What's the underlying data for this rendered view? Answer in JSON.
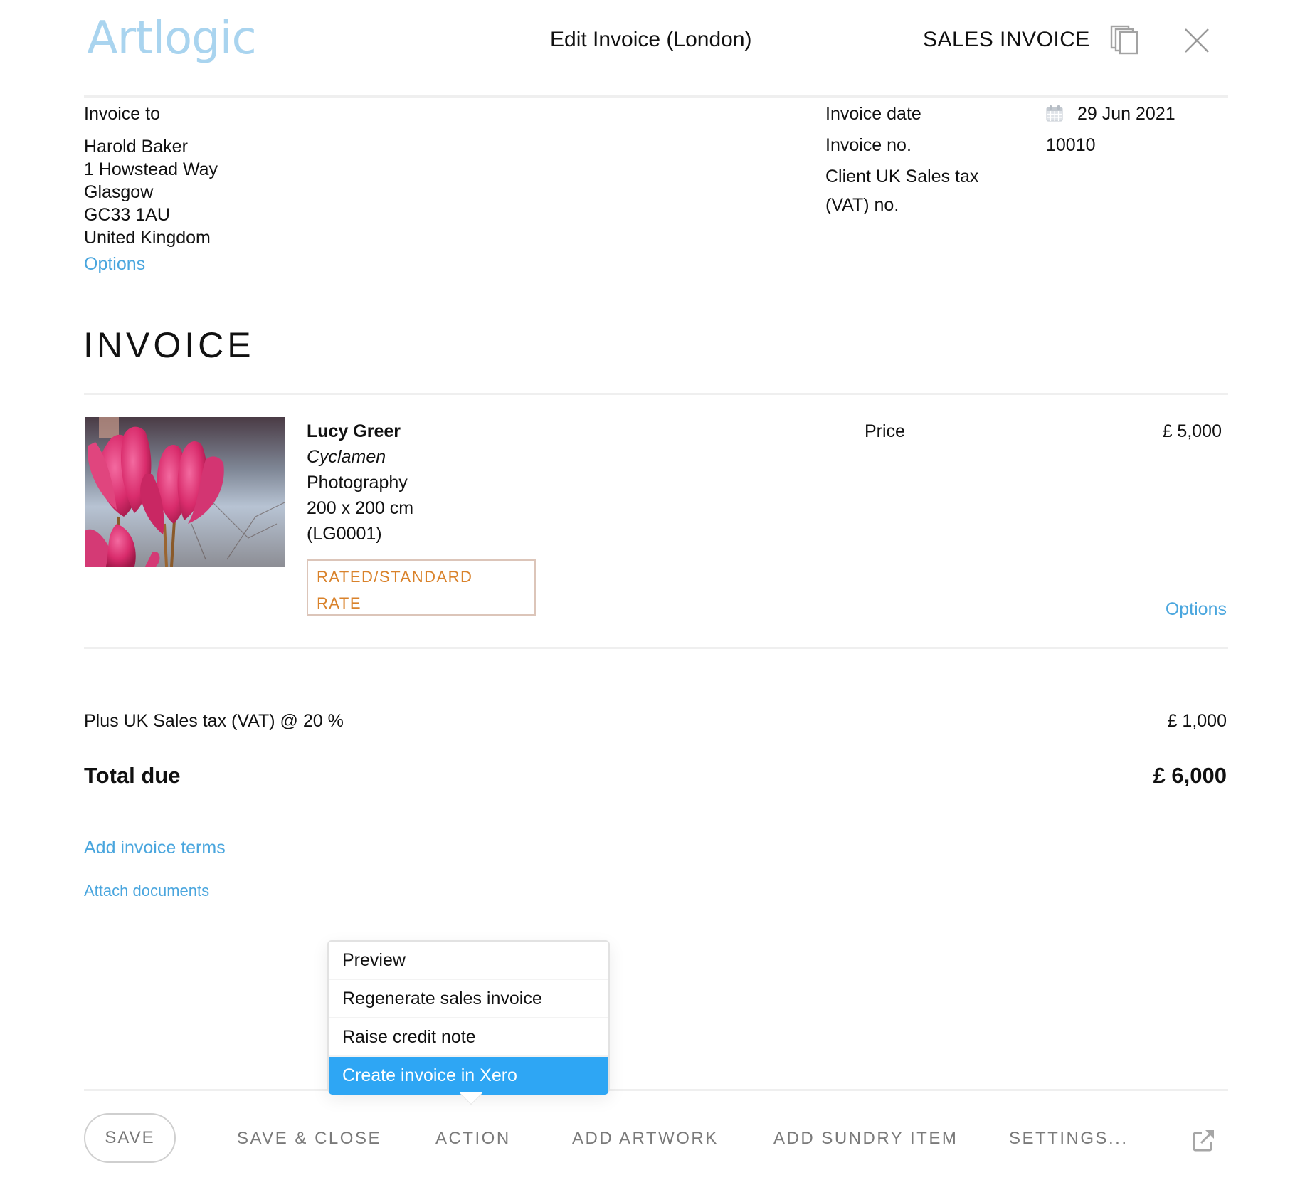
{
  "header": {
    "logo": "Artlogic",
    "title": "Edit Invoice (London)",
    "document_type": "SALES INVOICE",
    "icons": {
      "copy": "copy-icon",
      "close": "close-icon"
    }
  },
  "invoice_to": {
    "label": "Invoice to",
    "address_lines": [
      "Harold Baker",
      "1 Howstead Way",
      "Glasgow",
      "GC33 1AU",
      "United Kingdom"
    ],
    "options_link": "Options"
  },
  "meta": {
    "date_label": "Invoice date",
    "date_value": "29 Jun 2021",
    "number_label": "Invoice no.",
    "number_value": "10010",
    "vat_label_line1": "Client UK Sales tax",
    "vat_label_line2": "(VAT) no.",
    "calendar_icon": "calendar-icon"
  },
  "heading": "INVOICE",
  "item": {
    "artist": "Lucy Greer",
    "title": "Cyclamen",
    "medium": "Photography",
    "dimensions": "200 x 200 cm",
    "stock_number": "(LG0001)",
    "tax_badge_line1": "RATED/STANDARD",
    "tax_badge_line2": "RATE",
    "price_label": "Price",
    "price_value": "£ 5,000",
    "options_link": "Options",
    "image_alt": "Cyclamen photograph"
  },
  "totals": {
    "vat_label": "Plus UK Sales tax (VAT) @ 20 %",
    "vat_value": "£ 1,000",
    "total_label": "Total due",
    "total_value": "£ 6,000"
  },
  "links": {
    "add_terms": "Add invoice terms",
    "attach_documents": "Attach documents"
  },
  "action_menu": {
    "items": [
      {
        "label": "Preview",
        "active": false
      },
      {
        "label": "Regenerate sales invoice",
        "active": false
      },
      {
        "label": "Raise credit note",
        "active": false
      },
      {
        "label": "Create invoice in Xero",
        "active": true
      }
    ]
  },
  "footer": {
    "save": "SAVE",
    "save_close": "SAVE & CLOSE",
    "action": "ACTION",
    "add_artwork": "ADD ARTWORK",
    "add_sundry": "ADD SUNDRY ITEM",
    "settings": "SETTINGS...",
    "external_icon": "external-link-icon"
  },
  "colors": {
    "logo": "#a9d4ef",
    "link": "#4aa6de",
    "menu_active": "#2ea6f4",
    "badge_text": "#d9822b",
    "badge_border": "#dcc5b9",
    "footer_text": "#7a7a7a"
  }
}
